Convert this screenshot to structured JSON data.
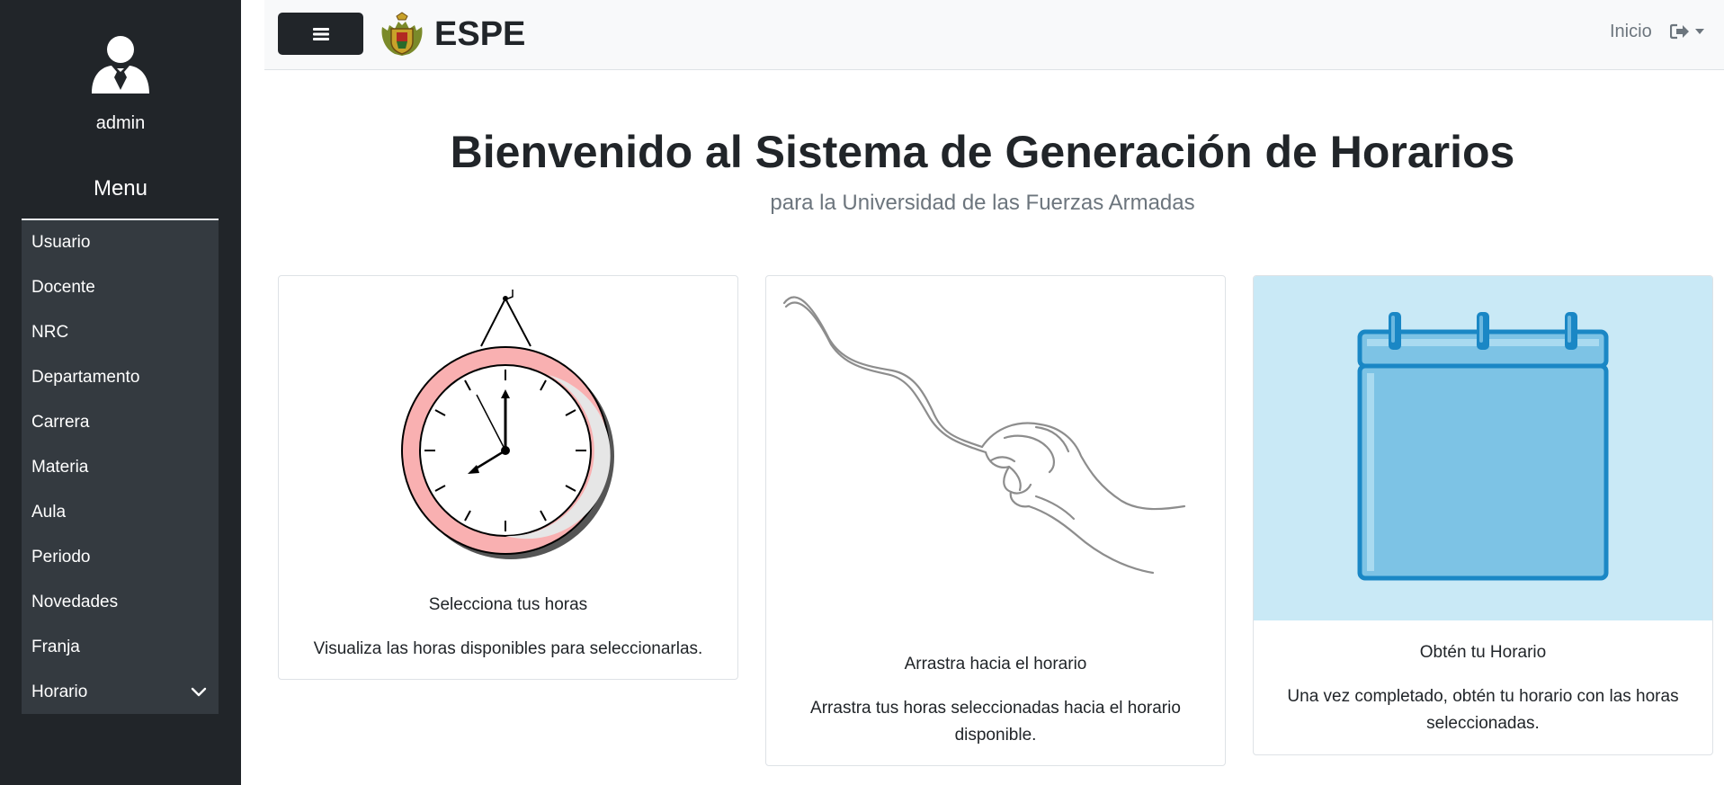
{
  "sidebar": {
    "username": "admin",
    "menu_title": "Menu",
    "items": [
      {
        "label": "Usuario"
      },
      {
        "label": "Docente"
      },
      {
        "label": "NRC"
      },
      {
        "label": "Departamento"
      },
      {
        "label": "Carrera"
      },
      {
        "label": "Materia"
      },
      {
        "label": "Aula"
      },
      {
        "label": "Periodo"
      },
      {
        "label": "Novedades"
      },
      {
        "label": "Franja"
      },
      {
        "label": "Horario"
      }
    ]
  },
  "navbar": {
    "toggle_icon": "hamburger-icon",
    "brand": "ESPE",
    "inicio": "Inicio",
    "logout_icon": "sign-out-icon"
  },
  "main": {
    "title": "Bienvenido al Sistema de Generación de Horarios",
    "subtitle": "para la Universidad de las Fuerzas Armadas"
  },
  "cards": [
    {
      "title": "Selecciona tus horas",
      "text": "Visualiza las horas disponibles para seleccionarlas.",
      "image": "clock"
    },
    {
      "title": "Arrastra hacia el horario",
      "text": "Arrastra tus horas seleccionadas hacia el horario disponible.",
      "image": "hand-drag"
    },
    {
      "title": "Obtén tu Horario",
      "text": "Una vez completado, obtén tu horario con las horas seleccionadas.",
      "image": "calendar"
    }
  ],
  "colors": {
    "sidebar_bg": "#212529",
    "menu_bg": "#343a40",
    "navbar_bg": "#f8f9fa",
    "calendar_bg": "#c9e9f6",
    "calendar_blue": "#1a87c5",
    "clock_ring": "#f9b0b1"
  }
}
